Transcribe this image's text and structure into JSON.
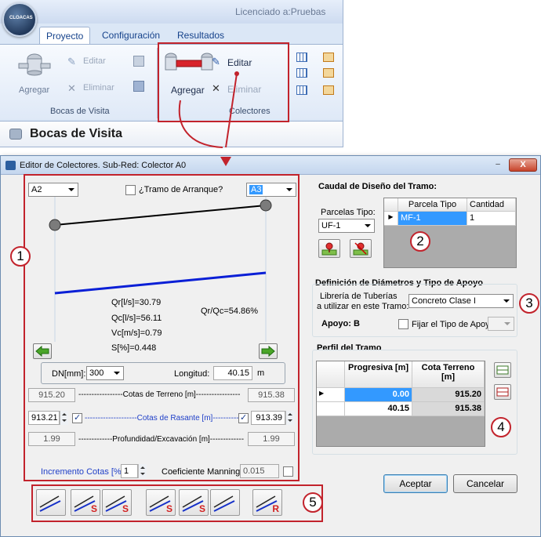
{
  "ribbon": {
    "license": "Licenciado a:Pruebas",
    "orb_text": "CLOACAS",
    "tabs": [
      "Proyecto",
      "Configuración",
      "Resultados"
    ],
    "bocas_group": {
      "add": "Agregar",
      "edit": "Editar",
      "delete": "Eliminar",
      "label": "Bocas de Visita"
    },
    "colectores_group": {
      "add": "Agregar",
      "edit": "Editar",
      "delete": "Eliminar",
      "label": "Colectores"
    },
    "panel_title": "Bocas de Visita"
  },
  "dialog": {
    "title": "Editor de Colectores. Sub-Red: Colector A0",
    "close": "X",
    "left": {
      "start_node": "A2",
      "end_node": "A3",
      "arranque_label": "¿Tramo de Arranque?",
      "stats": {
        "qr": "Qr[l/s]=30.79",
        "qc": "Qc[l/s]=56.11",
        "vc": "Vc[m/s]=0.79",
        "s": "S[%]=0.448",
        "ratio": "Qr/Qc=54.86%"
      },
      "dn_label": "DN[mm]:",
      "dn_value": "300",
      "longitud_label": "Longitud:",
      "longitud_value": "40.15",
      "longitud_unit": "m",
      "terreno": {
        "left": "915.20",
        "right": "915.38",
        "label": "-----------------Cotas de Terreno [m]-----------------"
      },
      "rasante": {
        "left": "913.21",
        "right": "913.39",
        "label": "--------------------Cotas de Rasante [m]--------------------"
      },
      "profundidad": {
        "left": "1.99",
        "right": "1.99",
        "label": "-------------Profundidad/Excavación [m]-------------"
      },
      "incremento_label": "Incremento Cotas [%]:",
      "incremento_value": "1",
      "manning_label": "Coeficiente Manning:",
      "manning_value": "0.015"
    },
    "caudal": {
      "title": "Caudal de Diseño del Tramo:",
      "parcelas_label": "Parcelas Tipo:",
      "parcelas_value": "UF-1",
      "grid_headers": [
        "Parcela Tipo",
        "Cantidad"
      ],
      "grid_rows": [
        [
          "MF-1",
          "1"
        ]
      ]
    },
    "diametros": {
      "title": "Definición de Diámetros y Tipo de Apoyo",
      "libreria_label_1": "Librería de Tuberías",
      "libreria_label_2": "a utilizar en este Tramo:",
      "libreria_value": "Concreto Clase I",
      "apoyo_label": "Apoyo: B",
      "fijar_label": "Fijar el Tipo de Apoyo:"
    },
    "perfil": {
      "title": "Perfil del Tramo",
      "headers": [
        "Progresiva [m]",
        "Cota Terreno [m]"
      ],
      "rows": [
        [
          "0.00",
          "915.20"
        ],
        [
          "40.15",
          "915.38"
        ]
      ]
    },
    "buttons": {
      "accept": "Aceptar",
      "cancel": "Cancelar"
    },
    "tool_letters": [
      "",
      "S",
      "S",
      "S",
      "S",
      "",
      "R"
    ]
  },
  "callouts": [
    "1",
    "2",
    "3",
    "4",
    "5"
  ],
  "colors": {
    "accent_red": "#c2232c",
    "pipe_blue": "#0a1fd6",
    "selection": "#3399ff"
  }
}
